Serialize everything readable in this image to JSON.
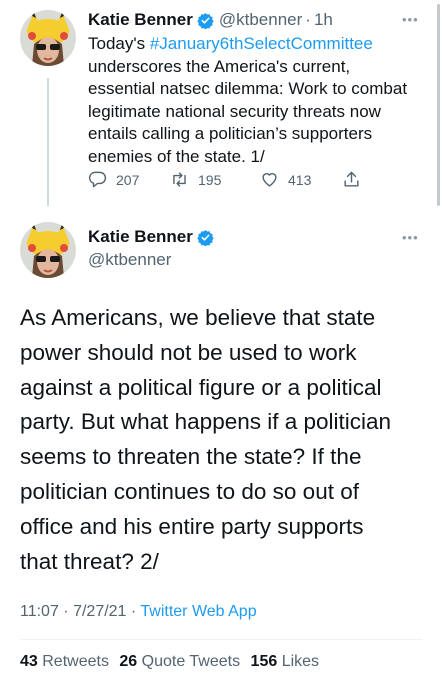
{
  "accent_color": "#1d9bf0",
  "tweet1": {
    "author_name": "Katie Benner",
    "handle": "@ktbenner",
    "separator": "·",
    "time": "1h",
    "lines": [
      {
        "prefix": "Today's ",
        "hashtag": "#January6thSelectCommittee"
      },
      {
        "text": "underscores the America's current,"
      },
      {
        "text": "essential natsec dilemma: Work to combat"
      },
      {
        "text": "legitimate national security threats now"
      },
      {
        "text": "entails calling a politician’s supporters"
      },
      {
        "text": "enemies of the state. 1/"
      }
    ],
    "replies": "207",
    "retweets": "195",
    "likes": "413",
    "icons": [
      "reply-icon",
      "retweet-icon",
      "like-icon",
      "share-icon"
    ]
  },
  "tweet2": {
    "author_name": "Katie Benner",
    "handle": "@ktbenner",
    "lines": [
      "As Americans, we believe that state",
      "power should not be used to work",
      "against a political figure or a political",
      "party. But what happens if a politician",
      "seems to threaten the state? If the",
      "politician continues to do so out of",
      "office and his entire party supports",
      "that threat? 2/"
    ],
    "time": "11:07 · 7/27/21 · ",
    "source": "Twitter Web App",
    "retweets_count": "43",
    "retweets_label": "Retweets",
    "quotes_count": "26",
    "quotes_label": "Quote Tweets",
    "likes_count": "156",
    "likes_label": "Likes"
  }
}
